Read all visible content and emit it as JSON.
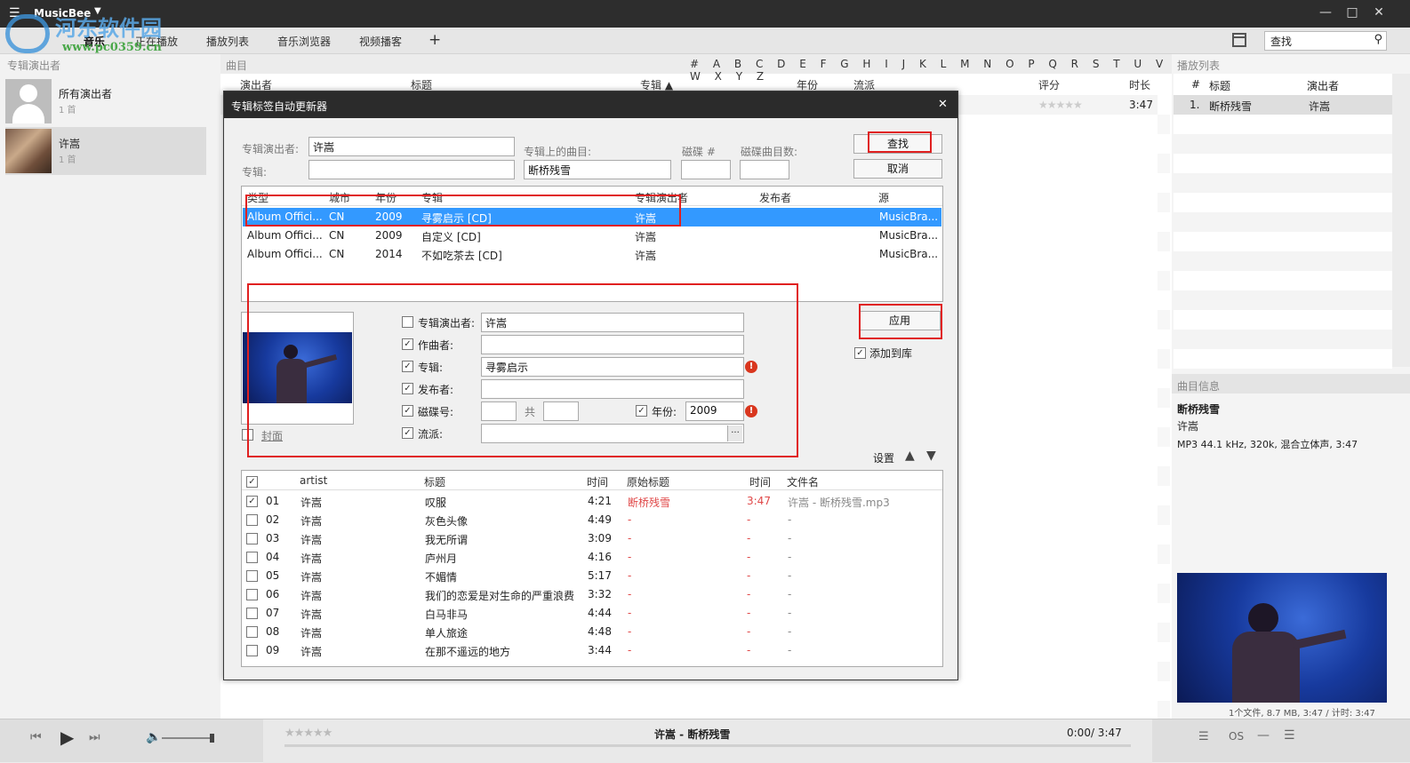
{
  "app": {
    "name": "MusicBee",
    "menu_icon": "hamburger-icon"
  },
  "window": {
    "minimize": "—",
    "maximize": "□",
    "close": "✕"
  },
  "watermark": {
    "title": "河东软件园",
    "url": "www.pc0359.cn"
  },
  "nav": {
    "tabs": [
      "音乐",
      "正在播放",
      "播放列表",
      "音乐浏览器",
      "视频播客"
    ],
    "add": "+",
    "search_label": "查找"
  },
  "left": {
    "header": "专辑演出者",
    "artists": [
      {
        "name": "所有演出者",
        "count": "1 首"
      },
      {
        "name": "许嵩",
        "count": "1 首"
      }
    ]
  },
  "center": {
    "header": "曲目",
    "alphabet": "# A B C D E F G H I J K L M N O P Q R S T U V W X Y Z",
    "columns": [
      "演出者",
      "标题",
      "专辑 ▲",
      "年份",
      "流派",
      "评分",
      "时长"
    ],
    "row_rating": "★★★★★",
    "row_duration": "3:47"
  },
  "right": {
    "header": "播放列表",
    "columns": [
      "#",
      "标题",
      "演出者"
    ],
    "row": {
      "num": "1.",
      "title": "断桥残雪",
      "artist": "许嵩"
    },
    "info_header": "曲目信息",
    "info_title": "断桥残雪",
    "info_artist": "许嵩",
    "info_tech": "MP3 44.1 kHz, 320k, 混合立体声, 3:47",
    "footer": "1个文件, 8.7 MB, 3:47 /   计时: 3:47"
  },
  "player": {
    "rating": "★★★★★",
    "now_playing": "许嵩 - 断桥残雪",
    "time": "0:00/ 3:47"
  },
  "dialog": {
    "title": "专辑标签自动更新器",
    "close": "✕",
    "album_artist_label": "专辑演出者:",
    "album_artist_value": "许嵩",
    "album_label": "专辑:",
    "album_value": "",
    "track_on_album_label": "专辑上的曲目:",
    "track_on_album_value": "断桥残雪",
    "disc_label": "磁碟 #",
    "disc_value": "",
    "disc_tracks_label": "磁碟曲目数:",
    "disc_tracks_value": "",
    "find_button": "查找",
    "cancel_button": "取消",
    "results_columns": [
      "类型",
      "城市",
      "年份",
      "专辑",
      "专辑演出者",
      "发布者",
      "源"
    ],
    "results": [
      {
        "type": "Album Offici...",
        "city": "CN",
        "year": "2009",
        "album": "寻雾启示  [CD]",
        "artist": "许嵩",
        "publisher": "",
        "source": "MusicBra..."
      },
      {
        "type": "Album Offici...",
        "city": "CN",
        "year": "2009",
        "album": "自定义  [CD]",
        "artist": "许嵩",
        "publisher": "",
        "source": "MusicBra..."
      },
      {
        "type": "Album Offici...",
        "city": "CN",
        "year": "2014",
        "album": "不如吃茶去  [CD]",
        "artist": "许嵩",
        "publisher": "",
        "source": "MusicBra..."
      }
    ],
    "cover_label": "封面",
    "fields": {
      "album_artist": {
        "label": "专辑演出者:",
        "value": "许嵩",
        "checked": false
      },
      "composer": {
        "label": "作曲者:",
        "value": "",
        "checked": true
      },
      "album": {
        "label": "专辑:",
        "value": "寻雾启示",
        "checked": true
      },
      "publisher": {
        "label": "发布者:",
        "value": "",
        "checked": true
      },
      "disc": {
        "label": "磁碟号:",
        "value": "",
        "of_label": "共",
        "of_value": "",
        "checked": true
      },
      "year": {
        "label": "年份:",
        "value": "2009",
        "checked": true
      },
      "genre": {
        "label": "流派:",
        "value": "",
        "button": "...",
        "checked": true
      }
    },
    "apply_button": "应用",
    "add_to_library": "添加到库",
    "settings": "设置",
    "up_icon": "🡅",
    "down_icon": "🡇",
    "track_columns": [
      "artist",
      "标题",
      "时间",
      "原始标题",
      "时间",
      "文件名"
    ],
    "tracks": [
      {
        "num": "01",
        "artist": "许嵩",
        "title": "叹服",
        "time": "4:21",
        "orig": "断桥残雪",
        "otime": "3:47",
        "file": "许嵩 - 断桥残雪.mp3",
        "checked": true
      },
      {
        "num": "02",
        "artist": "许嵩",
        "title": "灰色头像",
        "time": "4:49",
        "orig": "-",
        "otime": "-",
        "file": "-",
        "checked": false
      },
      {
        "num": "03",
        "artist": "许嵩",
        "title": "我无所谓",
        "time": "3:09",
        "orig": "-",
        "otime": "-",
        "file": "-",
        "checked": false
      },
      {
        "num": "04",
        "artist": "许嵩",
        "title": "庐州月",
        "time": "4:16",
        "orig": "-",
        "otime": "-",
        "file": "-",
        "checked": false
      },
      {
        "num": "05",
        "artist": "许嵩",
        "title": "不媚情",
        "time": "5:17",
        "orig": "-",
        "otime": "-",
        "file": "-",
        "checked": false
      },
      {
        "num": "06",
        "artist": "许嵩",
        "title": "我们的恋爱是对生命的严重浪费",
        "time": "3:32",
        "orig": "-",
        "otime": "-",
        "file": "-",
        "checked": false
      },
      {
        "num": "07",
        "artist": "许嵩",
        "title": "白马非马",
        "time": "4:44",
        "orig": "-",
        "otime": "-",
        "file": "-",
        "checked": false
      },
      {
        "num": "08",
        "artist": "许嵩",
        "title": "单人旅途",
        "time": "4:48",
        "orig": "-",
        "otime": "-",
        "file": "-",
        "checked": false
      },
      {
        "num": "09",
        "artist": "许嵩",
        "title": "在那不遥远的地方",
        "time": "3:44",
        "orig": "-",
        "otime": "-",
        "file": "-",
        "checked": false
      }
    ]
  },
  "colors": {
    "accent": "#3399ff",
    "highlight": "#e02020",
    "titlebar": "#2d2d2d",
    "warn": "#d9361e"
  }
}
